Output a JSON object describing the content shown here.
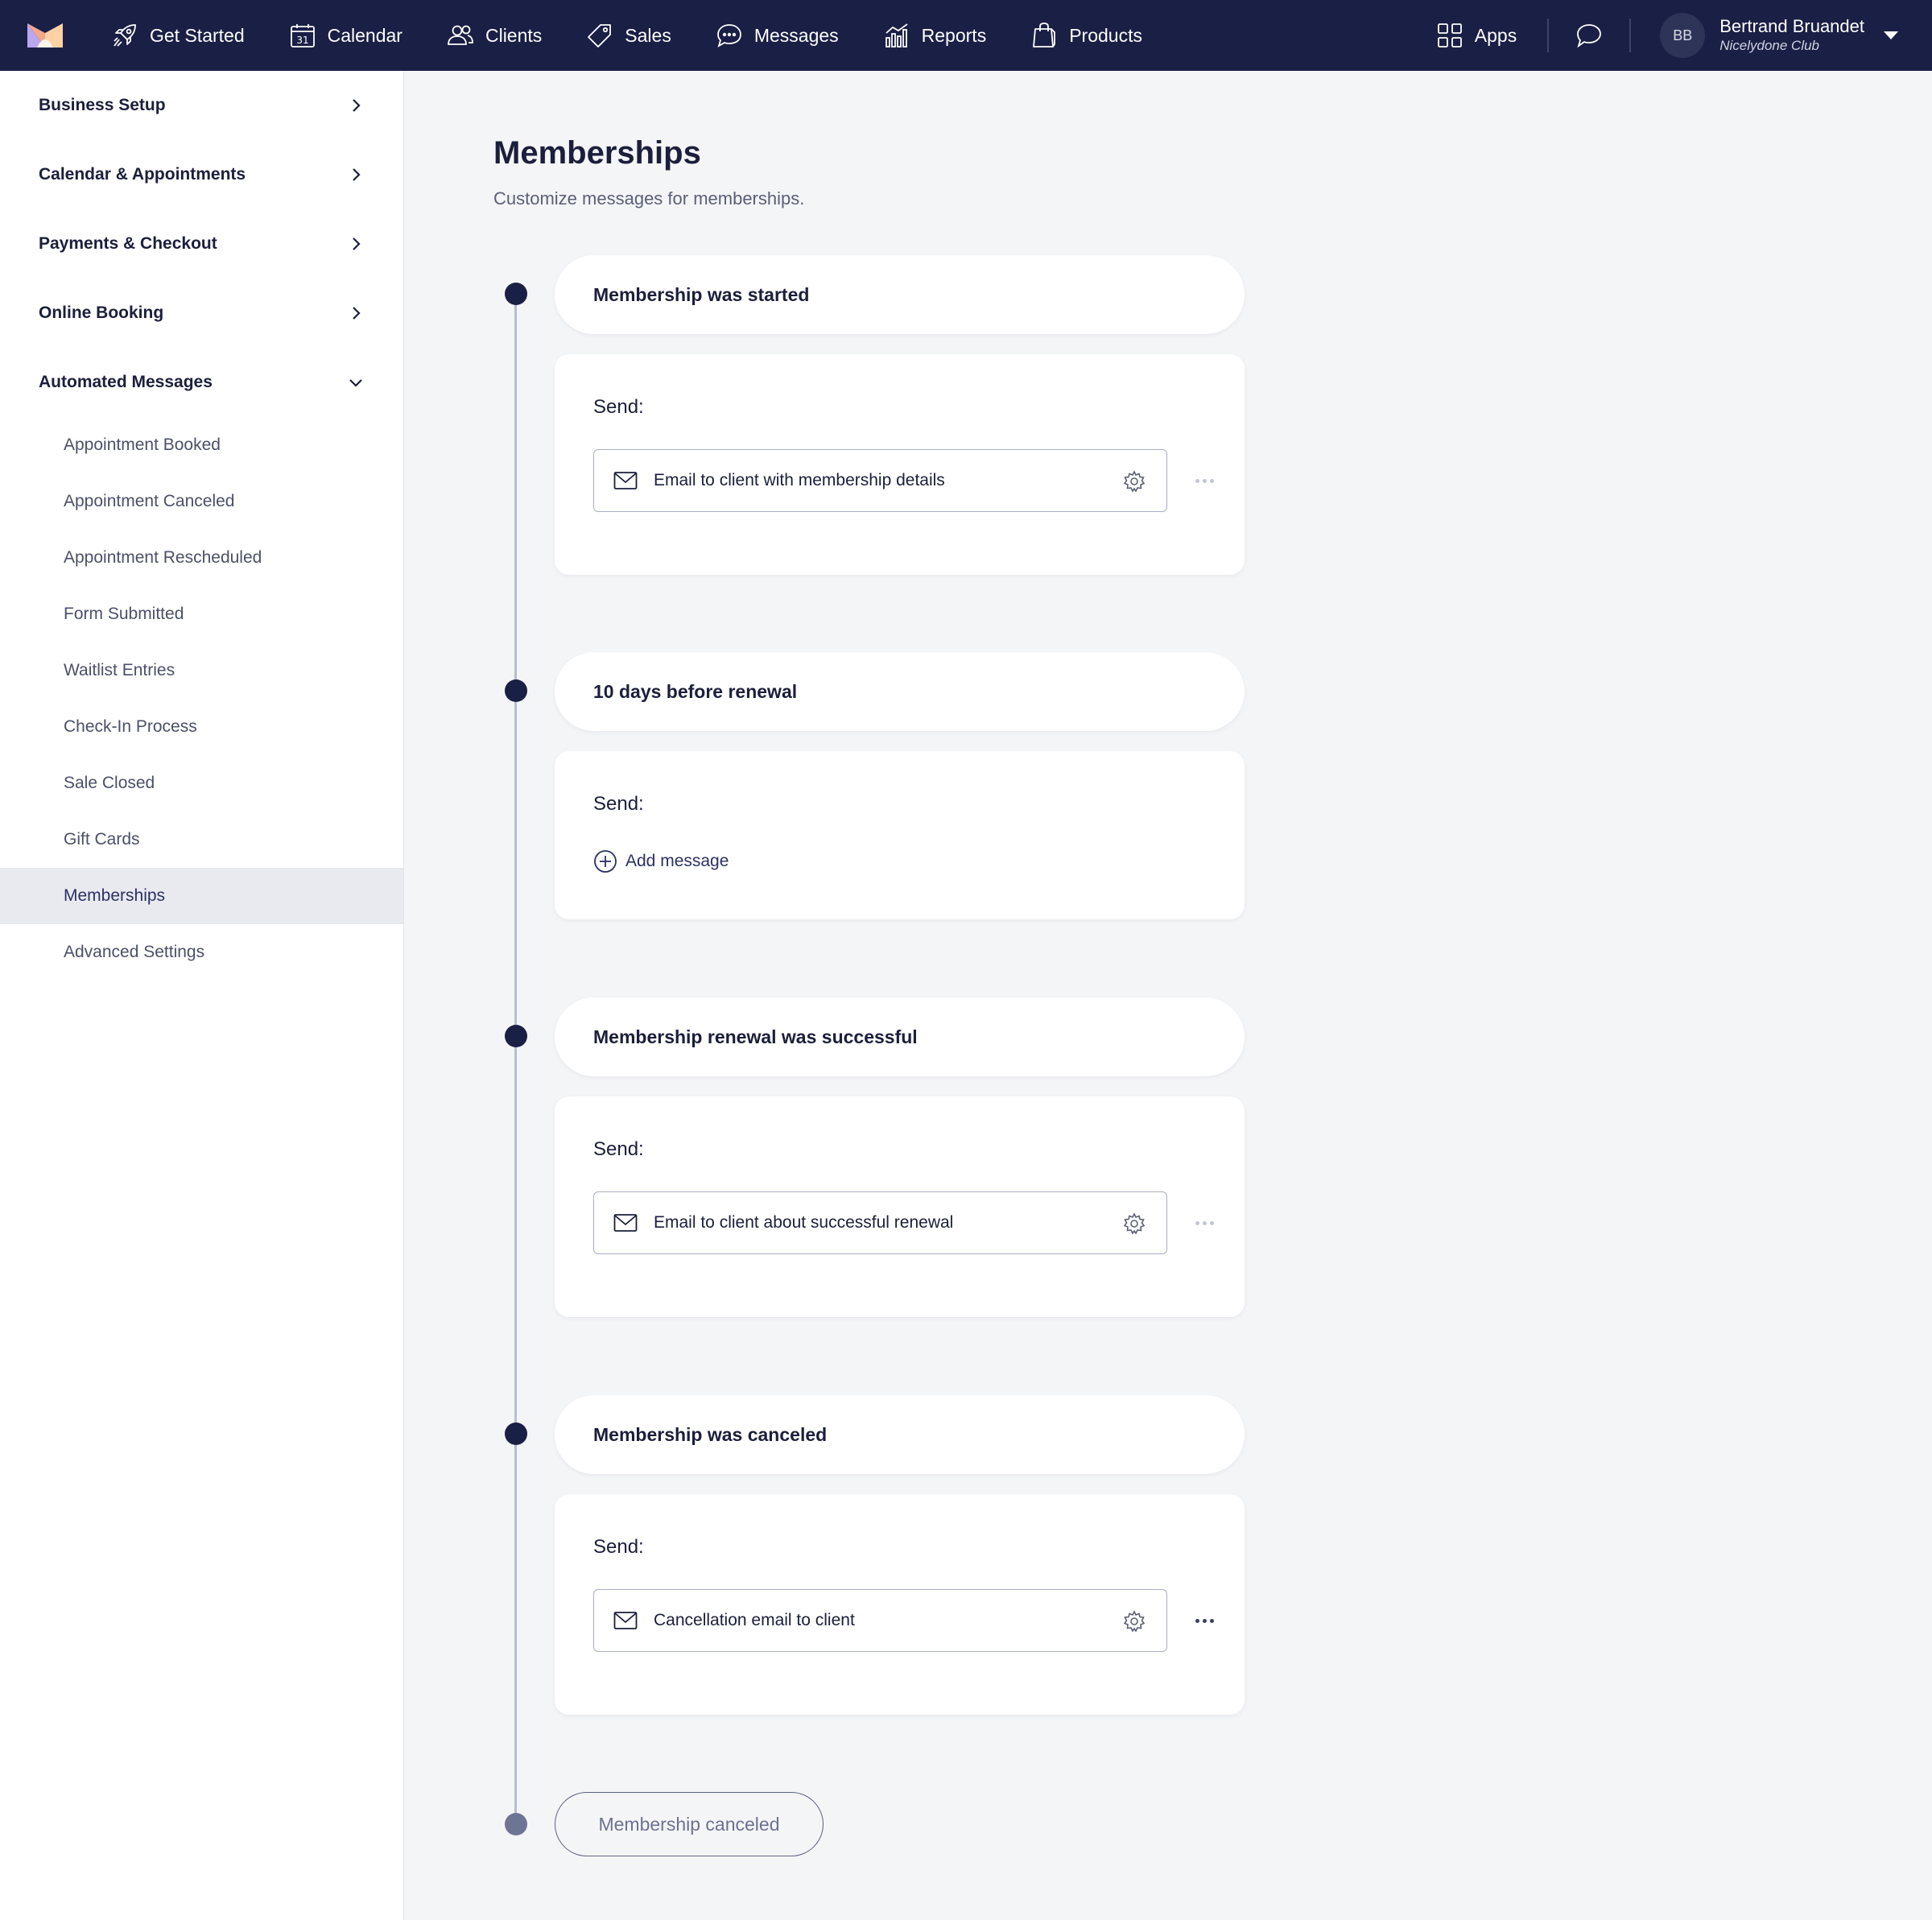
{
  "nav": {
    "items": [
      {
        "label": "Get Started",
        "icon": "rocket-icon"
      },
      {
        "label": "Calendar",
        "icon": "calendar-icon",
        "badge": "31"
      },
      {
        "label": "Clients",
        "icon": "clients-icon"
      },
      {
        "label": "Sales",
        "icon": "tag-icon"
      },
      {
        "label": "Messages",
        "icon": "message-bubble-icon"
      },
      {
        "label": "Reports",
        "icon": "bar-chart-icon"
      },
      {
        "label": "Products",
        "icon": "shopping-bag-icon"
      }
    ],
    "apps_label": "Apps",
    "user": {
      "initials": "BB",
      "name": "Bertrand Bruandet",
      "club": "Nicelydone Club"
    }
  },
  "sidebar": {
    "sections": [
      {
        "label": "Business Setup",
        "expanded": false
      },
      {
        "label": "Calendar & Appointments",
        "expanded": false
      },
      {
        "label": "Payments & Checkout",
        "expanded": false
      },
      {
        "label": "Online Booking",
        "expanded": false
      },
      {
        "label": "Automated Messages",
        "expanded": true
      }
    ],
    "sub_items": [
      {
        "label": "Appointment Booked",
        "active": false
      },
      {
        "label": "Appointment Canceled",
        "active": false
      },
      {
        "label": "Appointment Rescheduled",
        "active": false
      },
      {
        "label": "Form Submitted",
        "active": false
      },
      {
        "label": "Waitlist Entries",
        "active": false
      },
      {
        "label": "Check-In Process",
        "active": false
      },
      {
        "label": "Sale Closed",
        "active": false
      },
      {
        "label": "Gift Cards",
        "active": false
      },
      {
        "label": "Memberships",
        "active": true
      },
      {
        "label": "Advanced Settings",
        "active": false
      }
    ]
  },
  "main": {
    "title": "Memberships",
    "subtitle": "Customize messages for memberships.",
    "send_label": "Send:",
    "add_message_label": "Add message",
    "events": [
      {
        "label": "Membership was started",
        "message": "Email to client with membership details"
      },
      {
        "label": "10 days before renewal",
        "message": null
      },
      {
        "label": "Membership renewal was successful",
        "message": "Email to client about successful renewal"
      },
      {
        "label": "Membership was canceled",
        "message": "Cancellation email to client"
      }
    ],
    "end_label": "Membership canceled"
  },
  "colors": {
    "nav_bg": "#1a1f45",
    "accent": "#2b3163",
    "active_bg": "#e8eaf0",
    "page_bg": "#f4f5f7"
  }
}
